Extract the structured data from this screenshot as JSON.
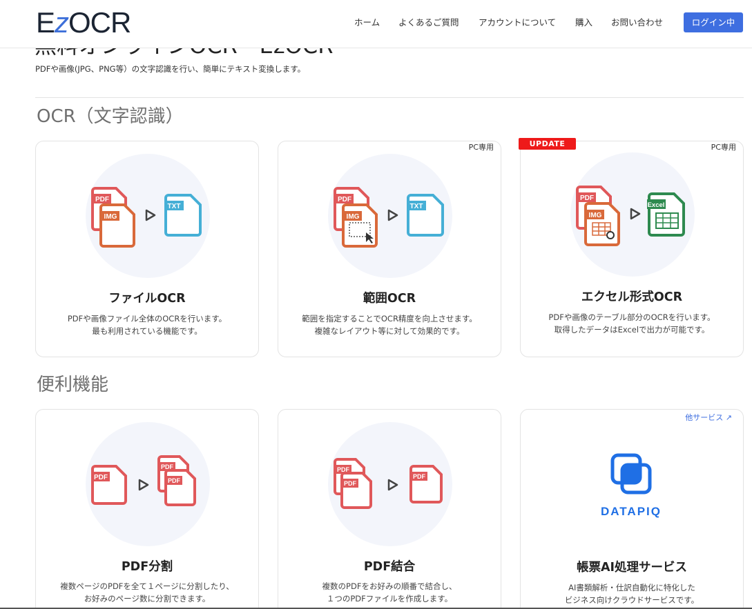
{
  "header": {
    "logo_prefix": "E",
    "logo_z": "z",
    "logo_suffix": "OCR",
    "nav": [
      "ホーム",
      "よくあるご質問",
      "アカウントについて",
      "購入",
      "お問い合わせ"
    ],
    "login_label": "ログイン中"
  },
  "hero": {
    "title": "無料オンラインOCR - EzOCR",
    "subtitle": "PDFや画像(JPG、PNG等）の文字認識を行い、簡単にテキスト変換します。"
  },
  "sections": {
    "ocr_title": "OCR（文字認識）",
    "tools_title": "便利機能"
  },
  "cards": {
    "file_ocr": {
      "title": "ファイルOCR",
      "desc1": "PDFや画像ファイル全体のOCRを行います。",
      "desc2": "最も利用されている機能です。",
      "icon_pdf": "PDF",
      "icon_img": "IMG",
      "icon_txt": "TXT"
    },
    "range_ocr": {
      "tag": "PC専用",
      "title": "範囲OCR",
      "desc1": "範囲を指定することでOCR精度を向上させます。",
      "desc2": "複雑なレイアウト等に対して効果的です。",
      "icon_pdf": "PDF",
      "icon_img": "IMG",
      "icon_txt": "TXT"
    },
    "excel_ocr": {
      "badge": "UPDATE",
      "tag": "PC専用",
      "title": "エクセル形式OCR",
      "desc1": "PDFや画像のテーブル部分のOCRを行います。",
      "desc2": "取得したデータはExcelで出力が可能です。",
      "icon_pdf": "PDF",
      "icon_img": "IMG",
      "icon_excel": "Excel"
    },
    "pdf_split": {
      "title": "PDF分割",
      "desc1": "複数ページのPDFを全て１ページに分割したり、",
      "desc2": "お好みのページ数に分割できます。",
      "icon_pdf": "PDF"
    },
    "pdf_merge": {
      "title": "PDF結合",
      "desc1": "複数のPDFをお好みの順番で結合し、",
      "desc2": "１つのPDFファイルを作成します。",
      "icon_pdf": "PDF"
    },
    "datapiq": {
      "other_link": "他サービス",
      "brand": "DATAPIQ",
      "title": "帳票AI処理サービス",
      "desc1": "AI書類解析・仕訳自動化に特化した",
      "desc2": "ビジネス向けクラウドサービスです。"
    }
  },
  "colors": {
    "accent": "#3e6ee0",
    "pdf_red": "#e0585a",
    "img_orange": "#d9693a",
    "txt_blue": "#45afd6",
    "excel_green": "#2e8a4f",
    "update_red": "#ee1a1a"
  }
}
